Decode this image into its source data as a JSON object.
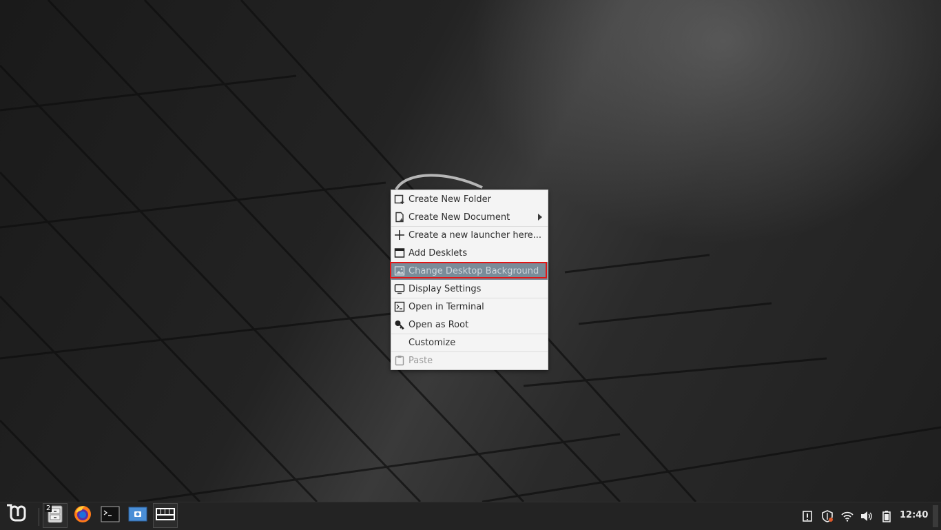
{
  "desktop": {
    "context_menu": {
      "items": [
        {
          "label": "Create New Folder",
          "icon": "new-folder-icon",
          "state": "normal"
        },
        {
          "label": "Create New Document",
          "icon": "new-document-icon",
          "state": "normal",
          "submenu": true
        },
        {
          "label": "Create a new launcher here...",
          "icon": "plus-icon",
          "state": "normal"
        },
        {
          "label": "Add Desklets",
          "icon": "desklet-icon",
          "state": "normal"
        },
        {
          "label": "Change Desktop Background",
          "icon": "image-icon",
          "state": "highlighted"
        },
        {
          "label": "Display Settings",
          "icon": "monitor-icon",
          "state": "normal"
        },
        {
          "label": "Open in Terminal",
          "icon": "terminal-icon",
          "state": "normal"
        },
        {
          "label": "Open as Root",
          "icon": "key-icon",
          "state": "normal"
        },
        {
          "label": "Customize",
          "icon": "",
          "state": "normal"
        },
        {
          "label": "Paste",
          "icon": "clipboard-icon",
          "state": "disabled"
        }
      ],
      "highlight_outline_color": "#e01616",
      "selected_color": "#7a8c99"
    }
  },
  "taskbar": {
    "menu_button": {
      "icon": "linux-mint-logo-icon"
    },
    "launchers": [
      {
        "name": "Files",
        "icon": "file-manager-icon",
        "badge": "2"
      },
      {
        "name": "Firefox",
        "icon": "firefox-icon"
      },
      {
        "name": "Terminal",
        "icon": "terminal-icon"
      },
      {
        "name": "Screenshot",
        "icon": "screenshot-icon"
      },
      {
        "name": "Workspace Switcher",
        "icon": "workspace-switcher-icon"
      }
    ],
    "tray": [
      "update-manager-icon",
      "shield-icon",
      "wifi-icon",
      "volume-icon",
      "battery-icon"
    ],
    "clock": "12:40"
  },
  "colors": {
    "taskbar_bg": "#232323",
    "menu_bg": "#f4f4f4"
  }
}
